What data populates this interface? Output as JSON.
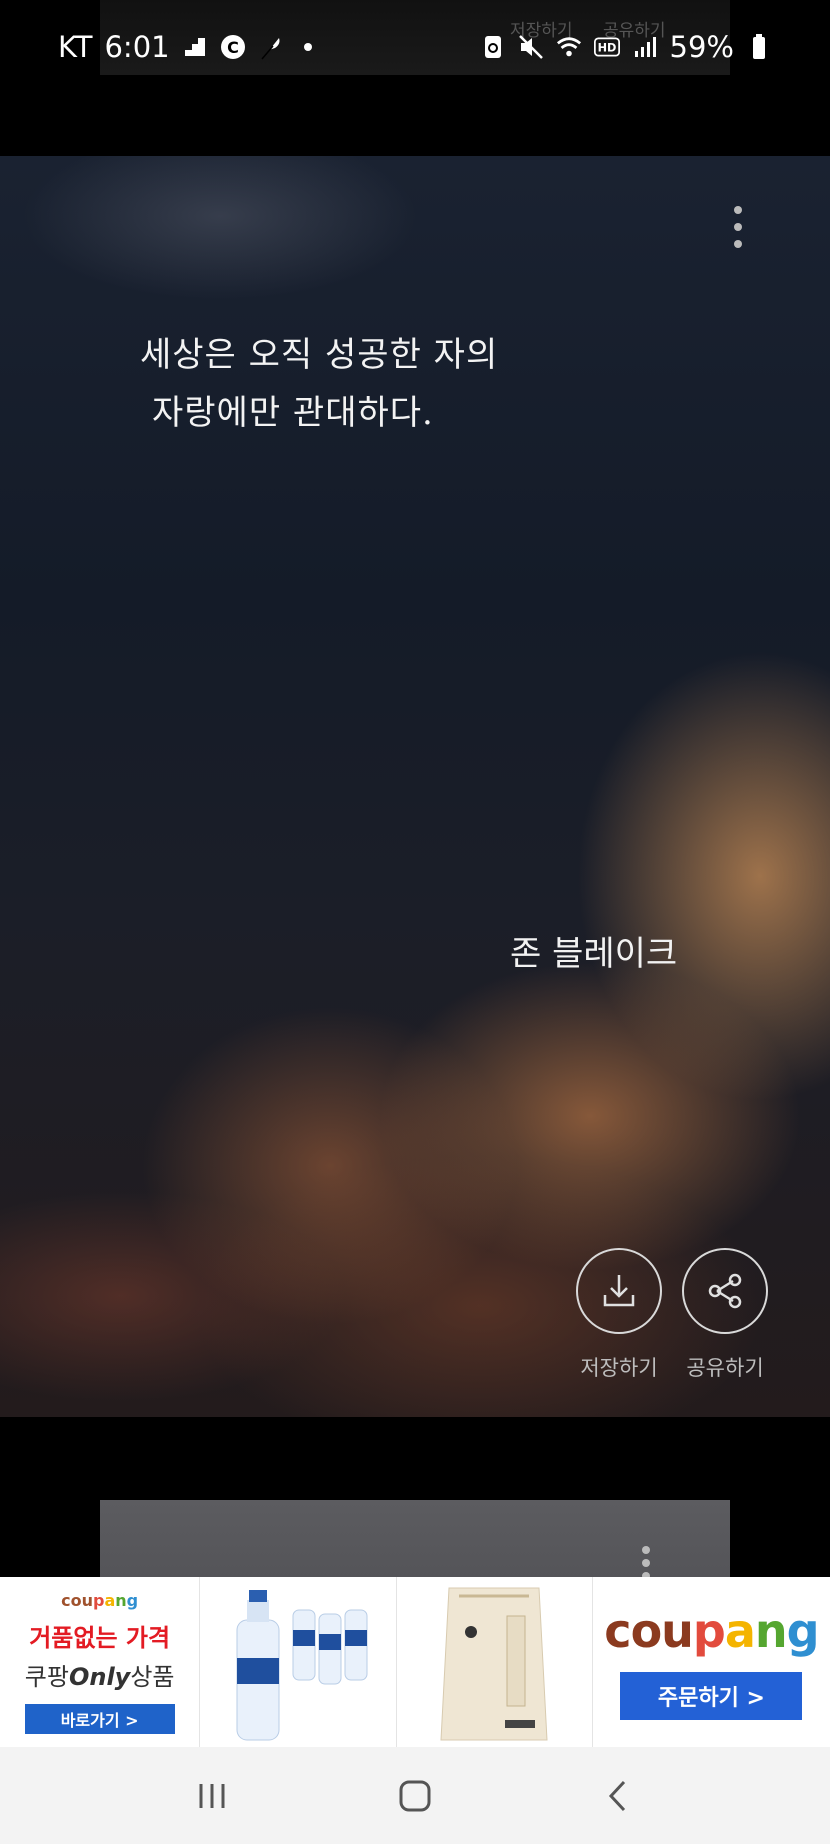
{
  "status_bar": {
    "carrier": "KT",
    "time": "6:01",
    "battery": "59%",
    "icons": [
      "stairs-icon",
      "c-circle-icon",
      "feather-icon",
      "dot-icon",
      "cloud-sync-icon",
      "mute-icon",
      "wifi-icon",
      "hd-icon",
      "signal-icon",
      "battery-icon"
    ]
  },
  "prev_card": {
    "save_label": "저장하기",
    "share_label": "공유하기"
  },
  "quote_card": {
    "quote_line1": "세상은 오직 성공한 자의",
    "quote_line2": "자랑에만 관대하다.",
    "author": "존 블레이크",
    "save_label": "저장하기",
    "share_label": "공유하기"
  },
  "ad_banner": {
    "brand_small": [
      "cou",
      "p",
      "a",
      "n",
      "g"
    ],
    "headline": "거품없는 가격",
    "sub_prefix": "쿠팡",
    "sub_emph": "Only",
    "sub_suffix": "상품",
    "small_button": "바로가기 >",
    "brand_big": [
      "cou",
      "p",
      "a",
      "n",
      "g"
    ],
    "big_button": "주문하기 >"
  },
  "nav_bar": {
    "icons": [
      "recent-apps-icon",
      "home-icon",
      "back-icon"
    ]
  }
}
